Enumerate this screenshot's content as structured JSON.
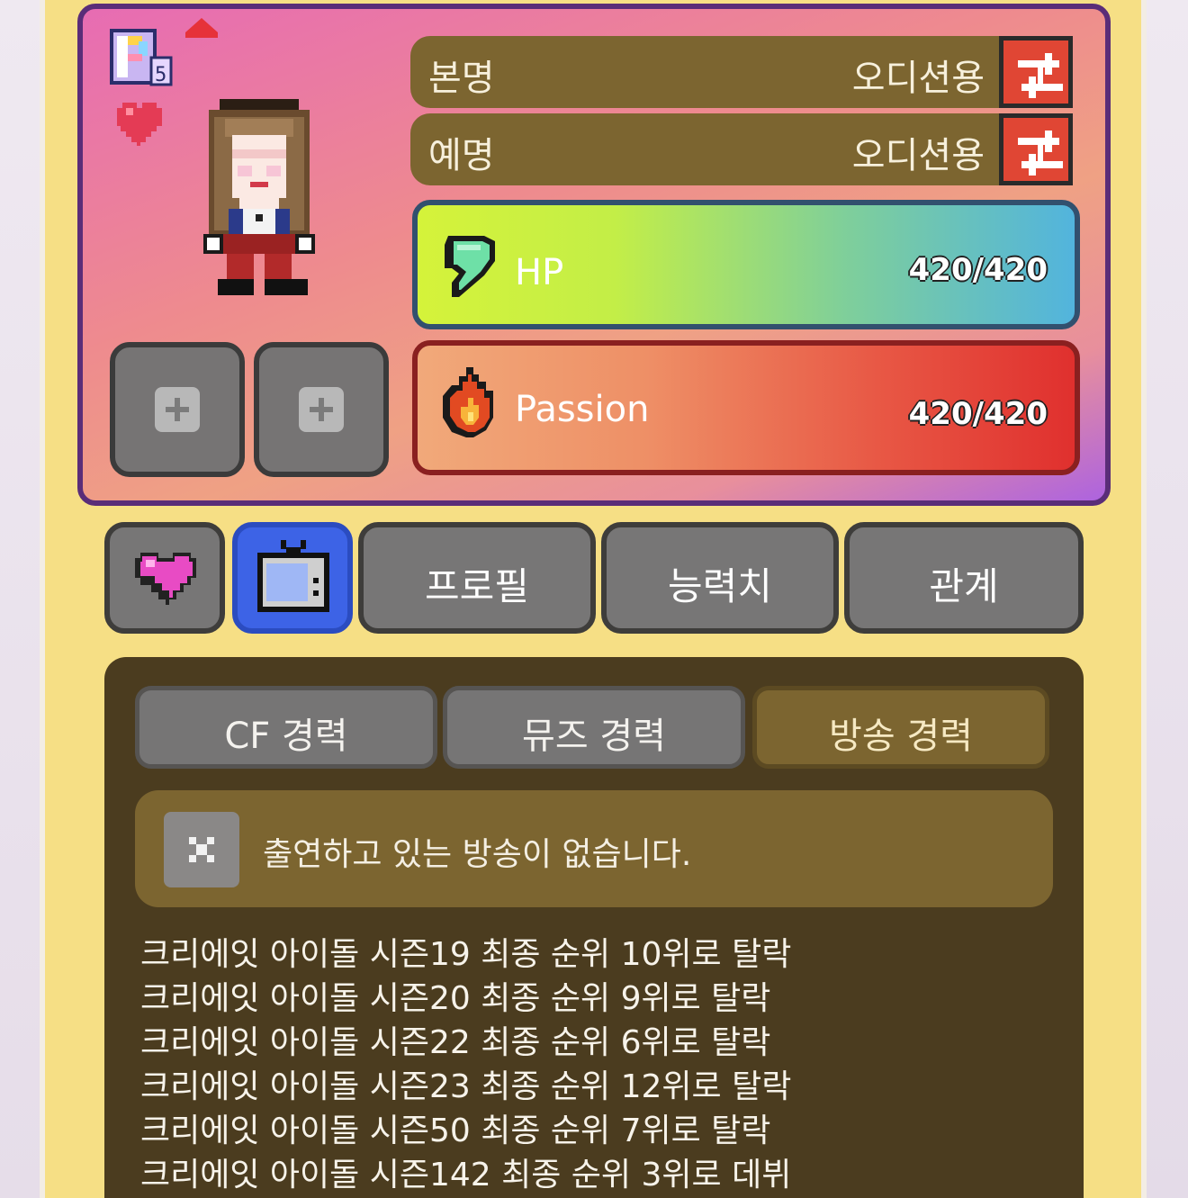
{
  "character": {
    "rank_badge": "P",
    "rank_level": "5",
    "real_name_label": "본명",
    "real_name_value": "오디션용",
    "stage_name_label": "예명",
    "stage_name_value": "오디션용"
  },
  "stats": {
    "hp_label": "HP",
    "hp_value": "420/420",
    "passion_label": "Passion",
    "passion_value": "420/420"
  },
  "nav_tabs": [
    {
      "id": "favorite",
      "icon": "heart-icon"
    },
    {
      "id": "broadcast",
      "icon": "tv-icon",
      "active": true
    },
    {
      "id": "profile",
      "label": "프로필"
    },
    {
      "id": "stats",
      "label": "능력치"
    },
    {
      "id": "relations",
      "label": "관계"
    }
  ],
  "career_tabs": [
    {
      "label": "CF 경력"
    },
    {
      "label": "뮤즈 경력"
    },
    {
      "label": "방송 경력",
      "active": true
    }
  ],
  "notice": "출연하고 있는 방송이 없습니다.",
  "career_history": [
    "크리에잇 아이돌 시즌19 최종 순위 10위로 탈락",
    "크리에잇 아이돌 시즌20 최종 순위 9위로 탈락",
    "크리에잇 아이돌 시즌22 최종 순위 6위로 탈락",
    "크리에잇 아이돌 시즌23 최종 순위 12위로 탈락",
    "크리에잇 아이돌 시즌50 최종 순위 7위로 탈락",
    "크리에잇 아이돌 시즌142 최종 순위 3위로 데뷔"
  ],
  "colors": {
    "frame": "#f6df85",
    "panel": "#4b3c1f",
    "active_tab": "#3d63e6",
    "swap_button": "#e04634"
  }
}
